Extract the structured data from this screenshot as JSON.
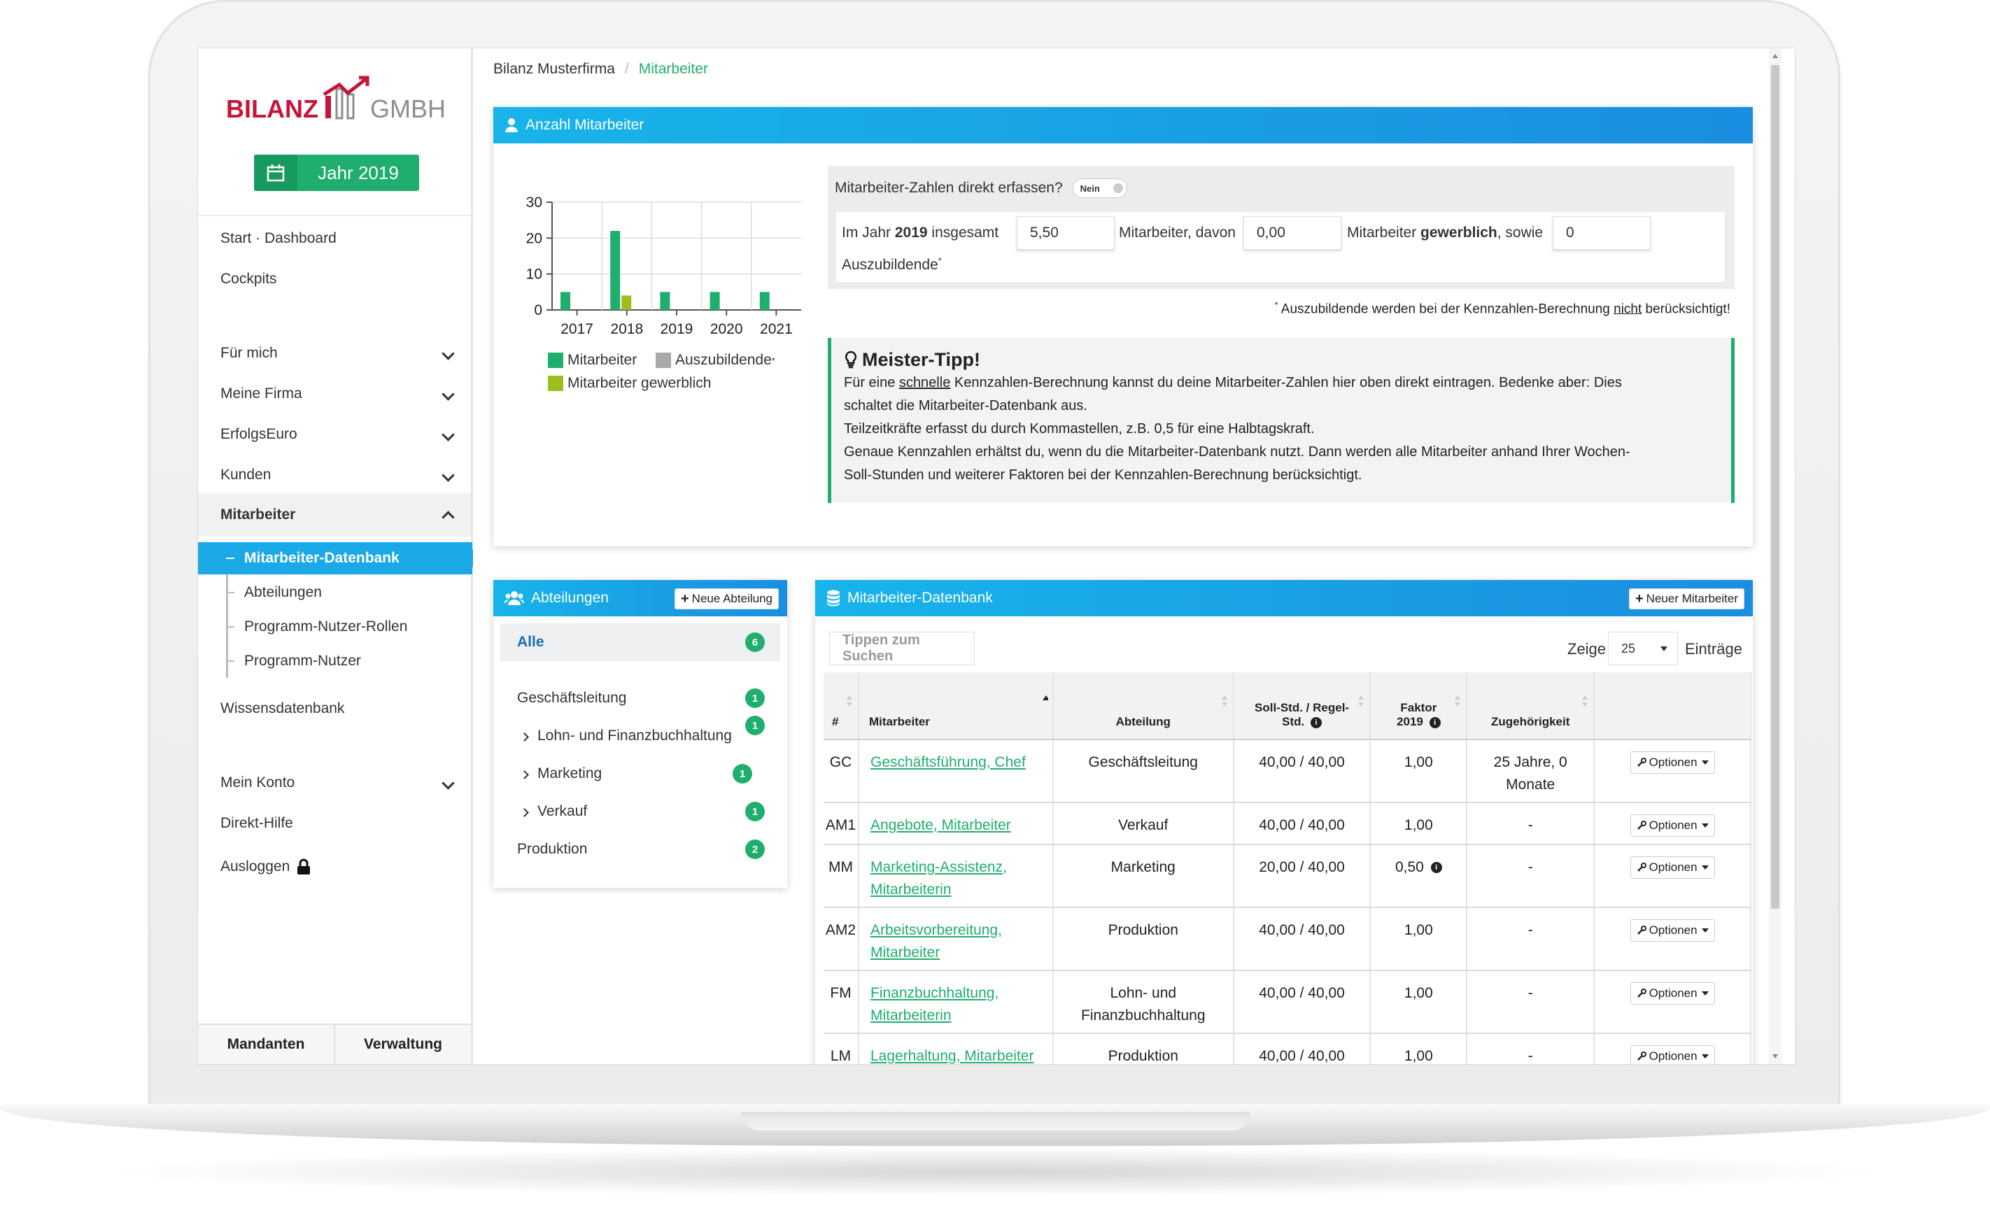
{
  "brand": {
    "left": "BILANZ",
    "right": "GMBH"
  },
  "year_button": "Jahr 2019",
  "nav": {
    "start": "Start · Dashboard",
    "cockpits": "Cockpits",
    "fuer_mich": "Für mich",
    "meine_firma": "Meine Firma",
    "erfolgseuro": "ErfolgsEuro",
    "kunden": "Kunden",
    "mitarbeiter": "Mitarbeiter",
    "sub": [
      "Mitarbeiter-Datenbank",
      "Abteilungen",
      "Programm-Nutzer-Rollen",
      "Programm-Nutzer"
    ],
    "wissensdatenbank": "Wissensdatenbank",
    "mein_konto": "Mein Konto",
    "direkt_hilfe": "Direkt-Hilfe",
    "ausloggen": "Ausloggen"
  },
  "footer": {
    "mandanten": "Mandanten",
    "verwaltung": "Verwaltung"
  },
  "breadcrumb": {
    "root": "Bilanz Musterfirma",
    "sep": "/",
    "current": "Mitarbeiter"
  },
  "anzahl": {
    "title": "Anzahl Mitarbeiter",
    "question": "Mitarbeiter-Zahlen direkt erfassen?",
    "toggle": "Nein",
    "im_jahr": "Im Jahr",
    "year": "2019",
    "insgesamt": "insgesamt",
    "total_value": "5,50",
    "mitarbeiter_davon": "Mitarbeiter, davon",
    "gewerblich_value": "0,00",
    "mitarbeiter": "Mitarbeiter",
    "gewerblich": "gewerblich",
    "sowie": ", sowie",
    "azubi_value": "0",
    "auszubildende": "Auszubildende",
    "star": "*",
    "note_a": "Auszubildende werden bei der Kennzahlen-Berechnung",
    "note_nicht": "nicht",
    "note_b": "berücksichtigt!"
  },
  "tip": {
    "title": "Meister-Tipp!",
    "l1a": "Für eine",
    "l1u": "schnelle",
    "l1b": "Kennzahlen-Berechnung kannst du deine Mitarbeiter-Zahlen hier oben direkt eintragen. Bedenke aber: Dies",
    "l2": "schaltet die Mitarbeiter-Datenbank aus.",
    "l3": "Teilzeitkräfte erfasst du durch Kommastellen, z.B. 0,5 für eine Halbtagskraft.",
    "l4": "Genaue Kennzahlen erhältst du, wenn du die Mitarbeiter-Datenbank nutzt. Dann werden alle Mitarbeiter anhand Ihrer Wochen-",
    "l5": "Soll-Stunden und weiterer Faktoren bei der Kennzahlen-Berechnung berücksichtigt."
  },
  "chart_data": {
    "type": "bar",
    "categories": [
      "2017",
      "2018",
      "2019",
      "2020",
      "2021"
    ],
    "ylim": [
      0,
      30
    ],
    "yticks": [
      "0",
      "10",
      "20",
      "30"
    ],
    "series": [
      {
        "name": "Mitarbeiter",
        "color": "#1fae6d",
        "values": [
          5,
          22,
          5,
          5,
          5
        ]
      },
      {
        "name": "Auszubildende",
        "color": "#a9a9a9",
        "values": [
          0,
          0,
          0,
          0,
          0
        ]
      },
      {
        "name": "Mitarbeiter gewerblich",
        "color": "#9cbf1e",
        "values": [
          0,
          4,
          0,
          0,
          0
        ]
      }
    ]
  },
  "legend": {
    "s1": "Mitarbeiter",
    "s2": "Auszubildende",
    "s3": "Mitarbeiter gewerblich"
  },
  "abteilungen": {
    "title": "Abteilungen",
    "new_button": "Neue Abteilung",
    "items": [
      {
        "label": "Alle",
        "count": "6"
      },
      {
        "label": "Geschäftsleitung",
        "count": "1"
      },
      {
        "label": "Lohn- und Finanzbuchhaltung",
        "count": "1"
      },
      {
        "label": "Marketing",
        "count": "1"
      },
      {
        "label": "Verkauf",
        "count": "1"
      },
      {
        "label": "Produktion",
        "count": "2"
      }
    ]
  },
  "datenbank": {
    "title": "Mitarbeiter-Datenbank",
    "new_button": "Neuer Mitarbeiter",
    "search_placeholder": "Tippen zum Suchen",
    "zeige": "Zeige",
    "page_size": "25",
    "eintraege": "Einträge",
    "columns": {
      "nr": "#",
      "mitarbeiter": "Mitarbeiter",
      "abteilung": "Abteilung",
      "soll_a": "Soll-Std. / Regel-",
      "soll_b": "Std.",
      "faktor_a": "Faktor",
      "faktor_b": "2019",
      "zugehoerigkeit": "Zugehörigkeit"
    },
    "options_label": "Optionen",
    "rows": [
      {
        "code": "GC",
        "name1": "Geschäftsführung, Chef",
        "name2": "",
        "dept1": "Geschäftsleitung",
        "dept2": "",
        "soll": "40,00 / 40,00",
        "faktor": "1,00",
        "zug1": "25 Jahre, 0",
        "zug2": "Monate"
      },
      {
        "code": "AM1",
        "name1": "Angebote, Mitarbeiter",
        "name2": "",
        "dept1": "Verkauf",
        "dept2": "",
        "soll": "40,00 / 40,00",
        "faktor": "1,00",
        "zug1": "-",
        "zug2": ""
      },
      {
        "code": "MM",
        "name1": "Marketing-Assistenz,",
        "name2": "Mitarbeiterin",
        "dept1": "Marketing",
        "dept2": "",
        "soll": "20,00 / 40,00",
        "faktor": "0,50",
        "zug1": "-",
        "zug2": ""
      },
      {
        "code": "AM2",
        "name1": "Arbeitsvorbereitung,",
        "name2": "Mitarbeiter",
        "dept1": "Produktion",
        "dept2": "",
        "soll": "40,00 / 40,00",
        "faktor": "1,00",
        "zug1": "-",
        "zug2": ""
      },
      {
        "code": "FM",
        "name1": "Finanzbuchhaltung,",
        "name2": "Mitarbeiterin",
        "dept1": "Lohn- und",
        "dept2": "Finanzbuchhaltung",
        "soll": "40,00 / 40,00",
        "faktor": "1,00",
        "zug1": "-",
        "zug2": ""
      },
      {
        "code": "LM",
        "name1": "Lagerhaltung, Mitarbeiter",
        "name2": "",
        "dept1": "Produktion",
        "dept2": "",
        "soll": "40,00 / 40,00",
        "faktor": "1,00",
        "zug1": "-",
        "zug2": ""
      }
    ]
  }
}
